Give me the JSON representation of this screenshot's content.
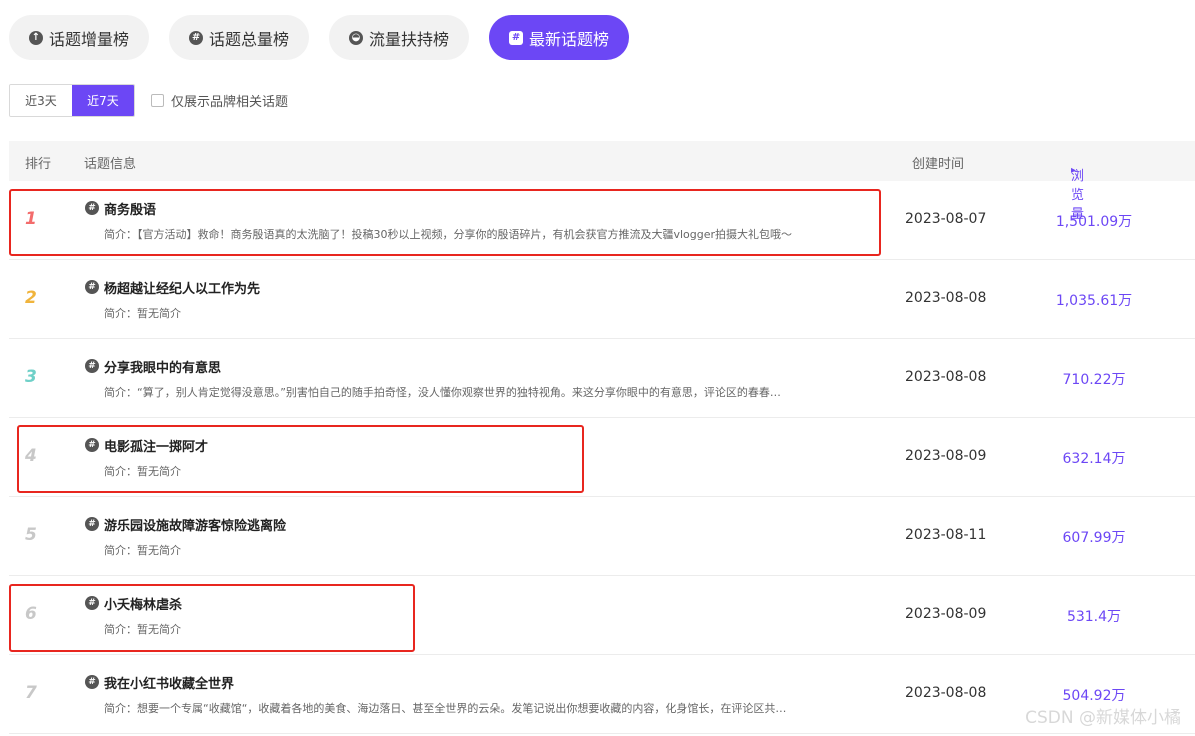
{
  "tabs": [
    {
      "label": "话题增量榜",
      "icon": "arrow-up-circle-icon",
      "active": false
    },
    {
      "label": "话题总量榜",
      "icon": "hashtag-circle-icon",
      "active": false
    },
    {
      "label": "流量扶持榜",
      "icon": "support-icon",
      "active": false
    },
    {
      "label": "最新话题榜",
      "icon": "hashtag-square-icon",
      "active": true
    }
  ],
  "filters": {
    "range_3d": "近3天",
    "range_7d": "近7天",
    "brand_only": "仅展示品牌相关话题"
  },
  "table": {
    "headers": {
      "rank": "排行",
      "info": "话题信息",
      "time": "创建时间",
      "views": "浏览量"
    },
    "desc_prefix": "简介：",
    "rows": [
      {
        "rank": "1",
        "title": "商务殷语",
        "desc": "简介：【官方活动】救命！商务殷语真的太洗脑了！投稿30秒以上视频，分享你的殷语碎片，有机会获官方推流及大疆vlogger拍摄大礼包哦～",
        "date": "2023-08-07",
        "views": "1,501.09万"
      },
      {
        "rank": "2",
        "title": "杨超越让经纪人以工作为先",
        "desc": "简介：暂无简介",
        "date": "2023-08-08",
        "views": "1,035.61万"
      },
      {
        "rank": "3",
        "title": "分享我眼中的有意思",
        "desc": "简介：“算了，别人肯定觉得没意思。”别害怕自己的随手拍奇怪，没人懂你观察世界的独特视角。来这分享你眼中的有意思，评论区的春春…",
        "date": "2023-08-08",
        "views": "710.22万"
      },
      {
        "rank": "4",
        "title": "电影孤注一掷阿才",
        "desc": "简介：暂无简介",
        "date": "2023-08-09",
        "views": "632.14万"
      },
      {
        "rank": "5",
        "title": "游乐园设施故障游客惊险逃离险",
        "desc": "简介：暂无简介",
        "date": "2023-08-11",
        "views": "607.99万"
      },
      {
        "rank": "6",
        "title": "小夭梅林虐杀",
        "desc": "简介：暂无简介",
        "date": "2023-08-09",
        "views": "531.4万"
      },
      {
        "rank": "7",
        "title": "我在小红书收藏全世界",
        "desc": "简介：想要一个专属“收藏馆“，收藏着各地的美食、海边落日、甚至全世界的云朵。发笔记说出你想要收藏的内容，化身馆长，在评论区共…",
        "date": "2023-08-08",
        "views": "504.92万"
      }
    ]
  },
  "watermark": "CSDN @新媒体小橘",
  "colors": {
    "accent": "#6c47f5",
    "highlight": "#e8261f"
  }
}
